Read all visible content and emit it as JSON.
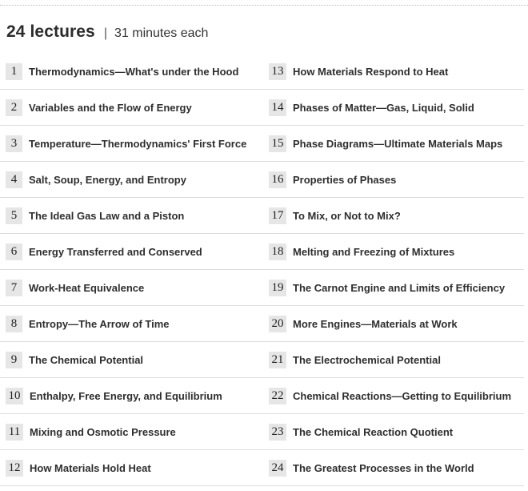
{
  "header": {
    "lecture_count": "24 lectures",
    "separator": "|",
    "duration": "31 minutes each"
  },
  "lectures_left": [
    {
      "number": "1",
      "title": "Thermodynamics—What's under the Hood"
    },
    {
      "number": "2",
      "title": "Variables and the Flow of Energy"
    },
    {
      "number": "3",
      "title": "Temperature—Thermodynamics' First Force"
    },
    {
      "number": "4",
      "title": "Salt, Soup, Energy, and Entropy"
    },
    {
      "number": "5",
      "title": "The Ideal Gas Law and a Piston"
    },
    {
      "number": "6",
      "title": "Energy Transferred and Conserved"
    },
    {
      "number": "7",
      "title": "Work-Heat Equivalence"
    },
    {
      "number": "8",
      "title": "Entropy—The Arrow of Time"
    },
    {
      "number": "9",
      "title": "The Chemical Potential"
    },
    {
      "number": "10",
      "title": "Enthalpy, Free Energy, and Equilibrium"
    },
    {
      "number": "11",
      "title": "Mixing and Osmotic Pressure"
    },
    {
      "number": "12",
      "title": "How Materials Hold Heat"
    }
  ],
  "lectures_right": [
    {
      "number": "13",
      "title": "How Materials Respond to Heat"
    },
    {
      "number": "14",
      "title": "Phases of Matter—Gas, Liquid, Solid"
    },
    {
      "number": "15",
      "title": "Phase Diagrams—Ultimate Materials Maps"
    },
    {
      "number": "16",
      "title": "Properties of Phases"
    },
    {
      "number": "17",
      "title": "To Mix, or Not to Mix?"
    },
    {
      "number": "18",
      "title": "Melting and Freezing of Mixtures"
    },
    {
      "number": "19",
      "title": "The Carnot Engine and Limits of Efficiency"
    },
    {
      "number": "20",
      "title": "More Engines—Materials at Work"
    },
    {
      "number": "21",
      "title": "The Electrochemical Potential"
    },
    {
      "number": "22",
      "title": "Chemical Reactions—Getting to Equilibrium"
    },
    {
      "number": "23",
      "title": "The Chemical Reaction Quotient"
    },
    {
      "number": "24",
      "title": "The Greatest Processes in the World"
    }
  ]
}
